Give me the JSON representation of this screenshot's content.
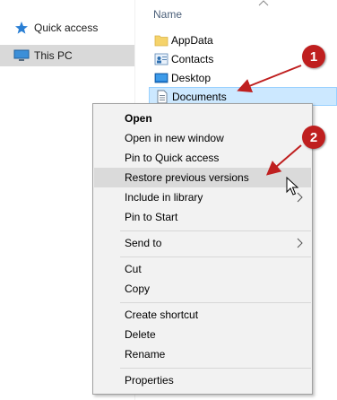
{
  "navigation": {
    "items": [
      {
        "label": "Quick access",
        "icon": "star-icon",
        "selected": false
      },
      {
        "label": "This PC",
        "icon": "monitor-icon",
        "selected": true
      }
    ]
  },
  "file_list": {
    "column_header": "Name",
    "items": [
      {
        "label": "AppData",
        "icon": "folder-icon"
      },
      {
        "label": "Contacts",
        "icon": "contacts-folder-icon"
      },
      {
        "label": "Desktop",
        "icon": "desktop-folder-icon"
      },
      {
        "label": "Documents",
        "icon": "documents-folder-icon",
        "selected": true
      }
    ]
  },
  "context_menu": {
    "groups": [
      [
        "Open",
        "Open in new window",
        "Pin to Quick access",
        "Restore previous versions",
        "Include in library",
        "Pin to Start"
      ],
      [
        "Send to"
      ],
      [
        "Cut",
        "Copy"
      ],
      [
        "Create shortcut",
        "Delete",
        "Rename"
      ],
      [
        "Properties"
      ]
    ],
    "default_item": "Open",
    "highlighted_item": "Restore previous versions",
    "submenu_items": [
      "Include in library",
      "Send to"
    ]
  },
  "annotations": {
    "step1": "1",
    "step2": "2",
    "color": "#bf1f1f"
  }
}
